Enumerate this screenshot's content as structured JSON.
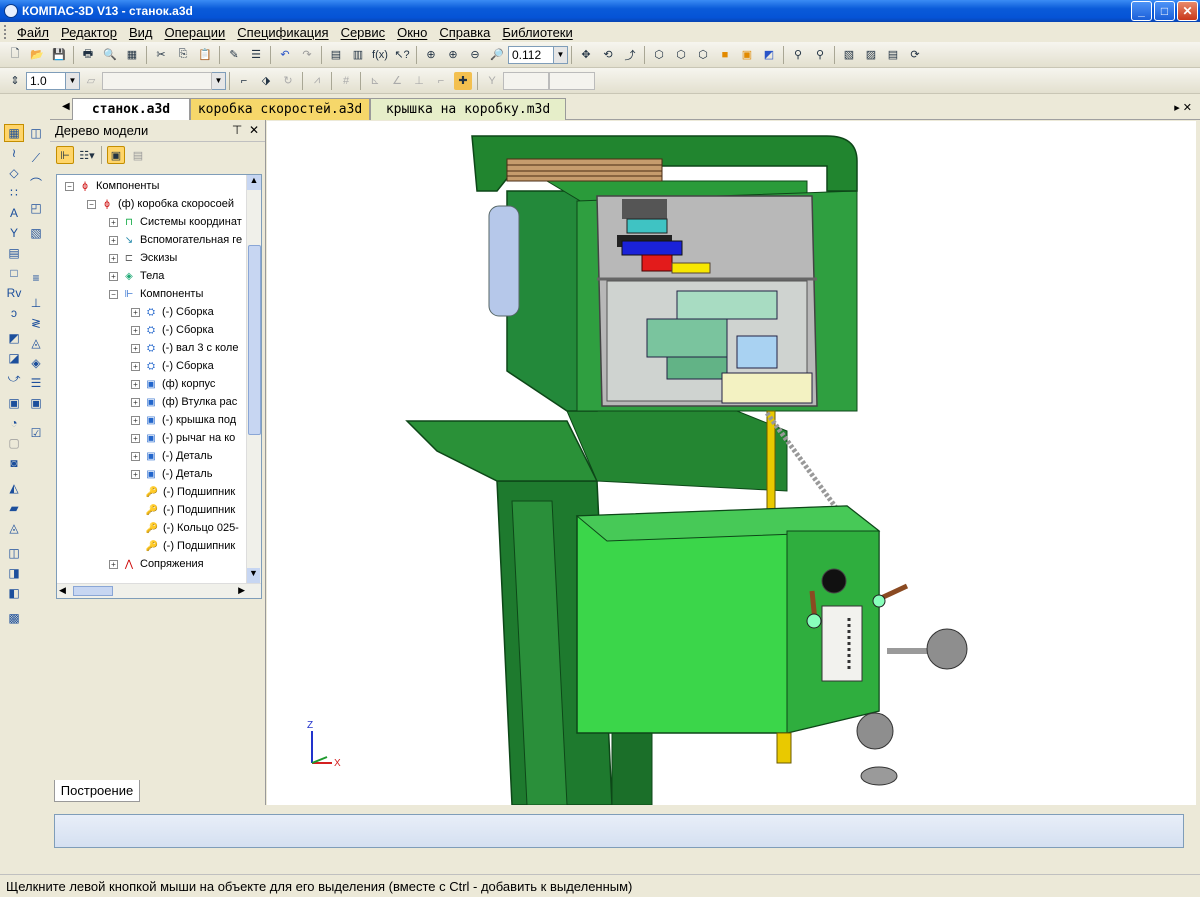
{
  "window": {
    "title": "КОМПАС-3D V13 - станок.a3d"
  },
  "menu": [
    "Файл",
    "Редактор",
    "Вид",
    "Операции",
    "Спецификация",
    "Сервис",
    "Окно",
    "Справка",
    "Библиотеки"
  ],
  "toolbar": {
    "zoom_value": "0.112",
    "step_value": "1.0"
  },
  "tabs": [
    {
      "label": "станок.a3d"
    },
    {
      "label": "коробка скоростей.a3d"
    },
    {
      "label": "крышка на коробку.m3d"
    }
  ],
  "tree": {
    "title": "Дерево модели",
    "items": [
      {
        "label": "Компоненты"
      },
      {
        "label": "(ф) коробка скоросоей"
      },
      {
        "label": "Системы координат"
      },
      {
        "label": "Вспомогательная ге"
      },
      {
        "label": "Эскизы"
      },
      {
        "label": "Тела"
      },
      {
        "label": "Компоненты"
      },
      {
        "label": "(-) Сборка"
      },
      {
        "label": "(-) Сборка"
      },
      {
        "label": "(-) вал 3 с коле"
      },
      {
        "label": "(-) Сборка"
      },
      {
        "label": "(ф) корпус"
      },
      {
        "label": "(ф) Втулка рас"
      },
      {
        "label": "(-) крышка под"
      },
      {
        "label": "(-) рычаг на ко"
      },
      {
        "label": "(-) Деталь"
      },
      {
        "label": "(-) Деталь"
      },
      {
        "label": "(-) Подшипник"
      },
      {
        "label": "(-) Подшипник"
      },
      {
        "label": "(-) Кольцо 025-"
      },
      {
        "label": "(-) Подшипник"
      },
      {
        "label": "Сопряжения"
      }
    ],
    "bottom_tab": "Построение"
  },
  "axes": {
    "z": "Z",
    "x": "X"
  },
  "status": {
    "text": "Щелкните левой кнопкой мыши на объекте для его выделения (вместе с Ctrl - добавить к выделенным)"
  },
  "colors": {
    "machine_dark": "#1e7a2e",
    "machine_light": "#35b845",
    "gearbox_bright": "#3bd64a",
    "title_blue": "#0a5bd9"
  }
}
